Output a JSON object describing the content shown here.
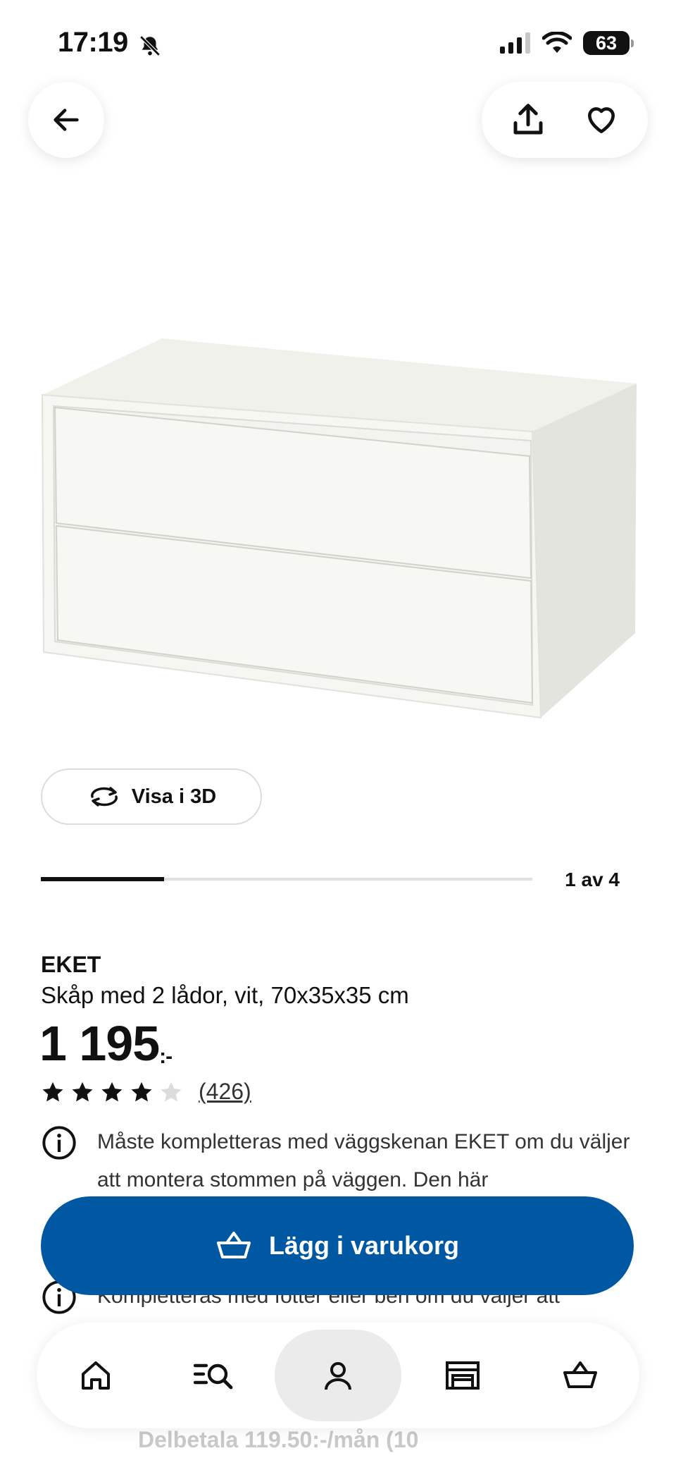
{
  "status_bar": {
    "time": "17:19",
    "battery": "63",
    "icons": [
      "bell-slash-icon",
      "cellular-signal-icon",
      "wifi-icon",
      "battery-icon"
    ]
  },
  "top_bar": {
    "icons": [
      "back-arrow-icon",
      "share-icon",
      "heart-icon"
    ]
  },
  "product_image": {
    "description_visible": false,
    "carousel": {
      "label": "1 av 4",
      "progress_fraction": 0.25
    }
  },
  "view_3d": {
    "label": "Visa i 3D",
    "icon": "rotate-3d-icon"
  },
  "product": {
    "brand": "EKET",
    "description": "Skåp med 2 lådor, vit, 70x35x35 cm",
    "price": "1 195",
    "price_suffix": ":-",
    "rating": {
      "stars": 4,
      "max": 5,
      "count": "(426)"
    }
  },
  "info": [
    {
      "icon": "info-icon",
      "text": "Måste kompletteras med väggskenan EKET om du väljer att montera stommen på väggen. Den här"
    },
    {
      "icon": "info-icon",
      "text": "Kompletteras med fötter eller ben om du väljer att"
    }
  ],
  "cart_button": {
    "label": "Lägg i varukorg",
    "icon": "basket-icon"
  },
  "bottom_nav": [
    {
      "name": "home",
      "icon": "home-icon",
      "active": false
    },
    {
      "name": "search",
      "icon": "search-list-icon",
      "active": false
    },
    {
      "name": "profile",
      "icon": "profile-icon",
      "active": true
    },
    {
      "name": "store",
      "icon": "store-icon",
      "active": false
    },
    {
      "name": "cart",
      "icon": "basket-icon",
      "active": false
    }
  ],
  "installment": {
    "text": "Delbetala 119.50:-/mån (10"
  },
  "colors": {
    "primary": "#0058a3",
    "text": "#111111",
    "muted": "#333333"
  }
}
